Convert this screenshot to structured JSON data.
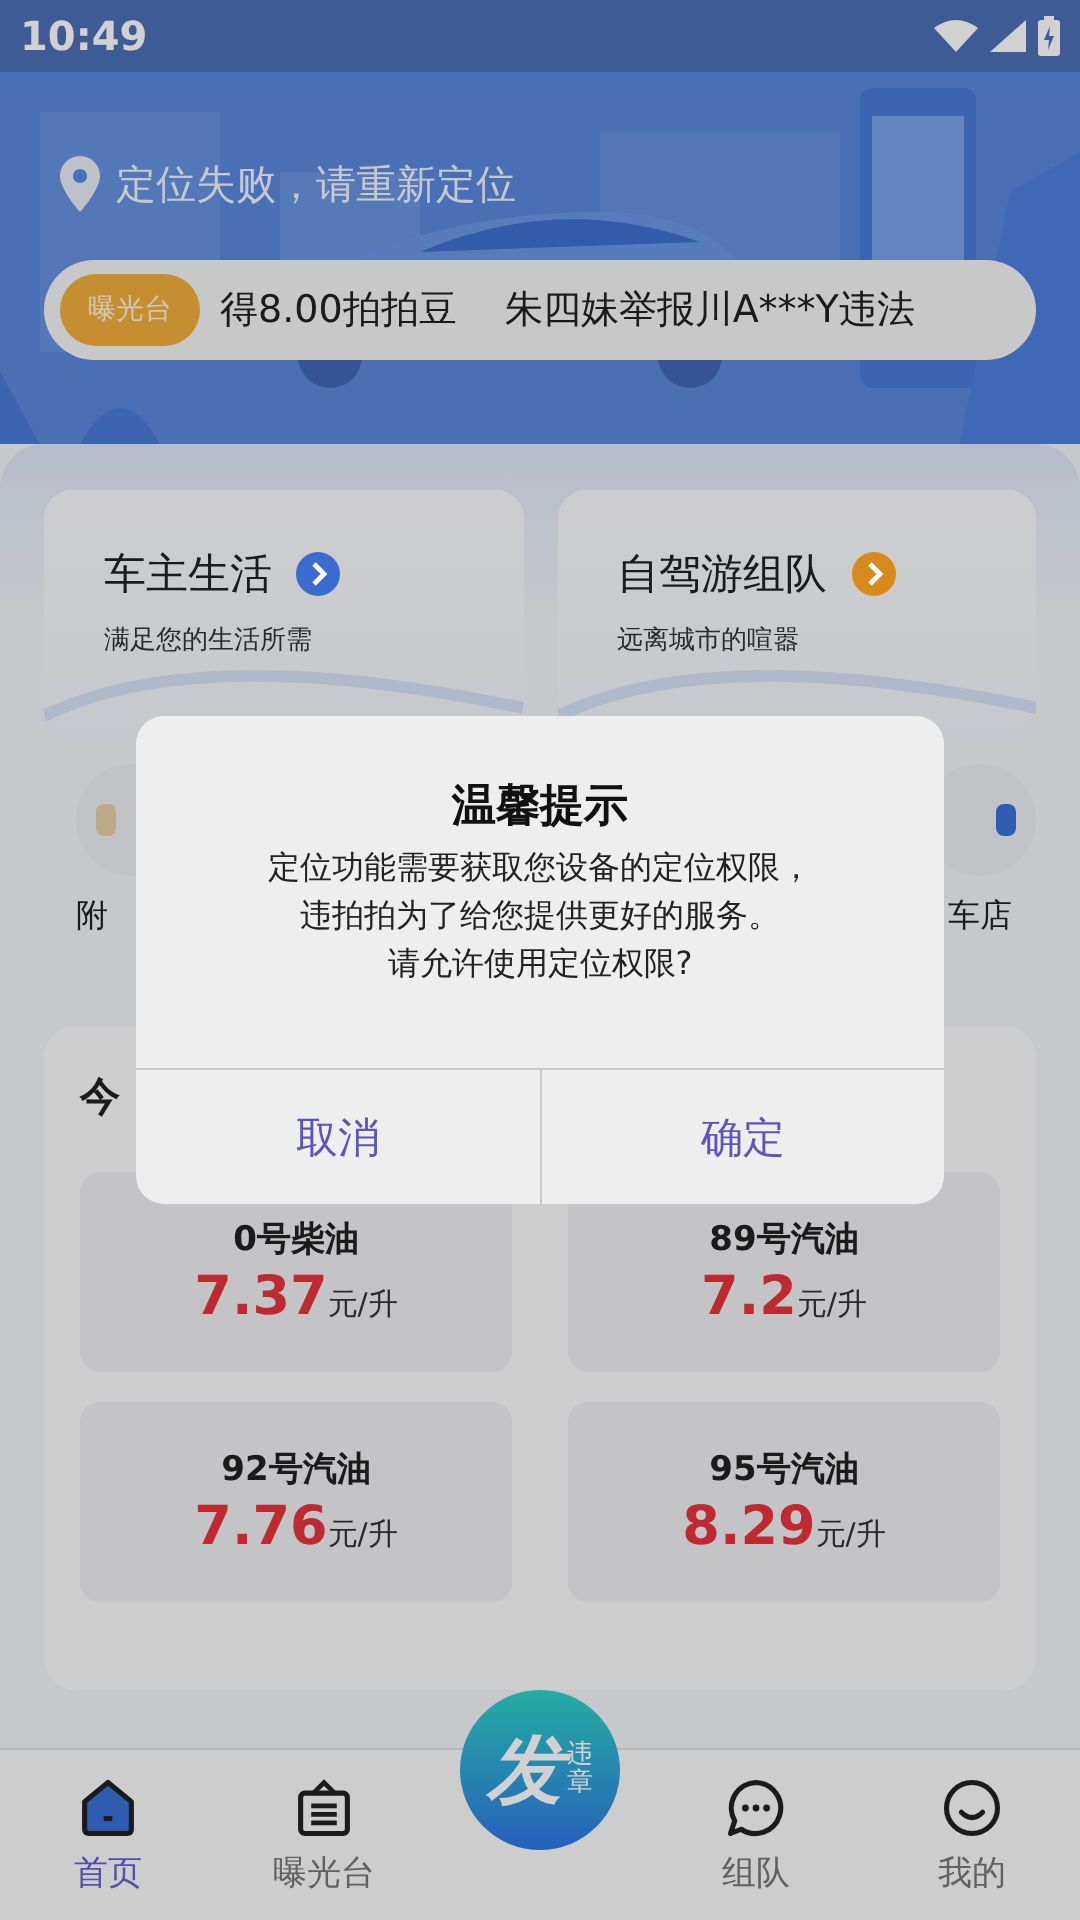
{
  "status_bar": {
    "time": "10:49"
  },
  "location": {
    "text": "定位失败，请重新定位"
  },
  "ticker": {
    "badge": "曝光台",
    "items": [
      "得8.00拍拍豆",
      "朱四妹举报川A***Y违法"
    ]
  },
  "feature_cards": [
    {
      "title": "车主生活",
      "subtitle": "满足您的生活所需",
      "color": "#3c6bd0"
    },
    {
      "title": "自驾游组队",
      "subtitle": "远离城市的喧嚣",
      "color": "#d88a1c"
    }
  ],
  "shortcuts": [
    {
      "label": "附"
    },
    {
      "label": "车店"
    }
  ],
  "fuel_prices": {
    "title": "今",
    "items": [
      {
        "name": "0号柴油",
        "price": "7.37",
        "unit": "元/升"
      },
      {
        "name": "89号汽油",
        "price": "7.2",
        "unit": "元/升"
      },
      {
        "name": "92号汽油",
        "price": "7.76",
        "unit": "元/升"
      },
      {
        "name": "95号汽油",
        "price": "8.29",
        "unit": "元/升"
      }
    ]
  },
  "tab_bar": {
    "tabs": [
      {
        "label": "首页",
        "selected": true
      },
      {
        "label": "曝光台",
        "selected": false
      },
      {
        "label": "组队",
        "selected": false
      },
      {
        "label": "我的",
        "selected": false
      }
    ],
    "post_button": {
      "main": "发",
      "side": "违章"
    }
  },
  "dialog": {
    "title": "温馨提示",
    "message_lines": [
      "定位功能需要获取您设备的定位权限，",
      "违拍拍为了给您提供更好的服务。",
      "请允许使用定位权限?"
    ],
    "buttons": [
      "取消",
      "确定"
    ]
  }
}
